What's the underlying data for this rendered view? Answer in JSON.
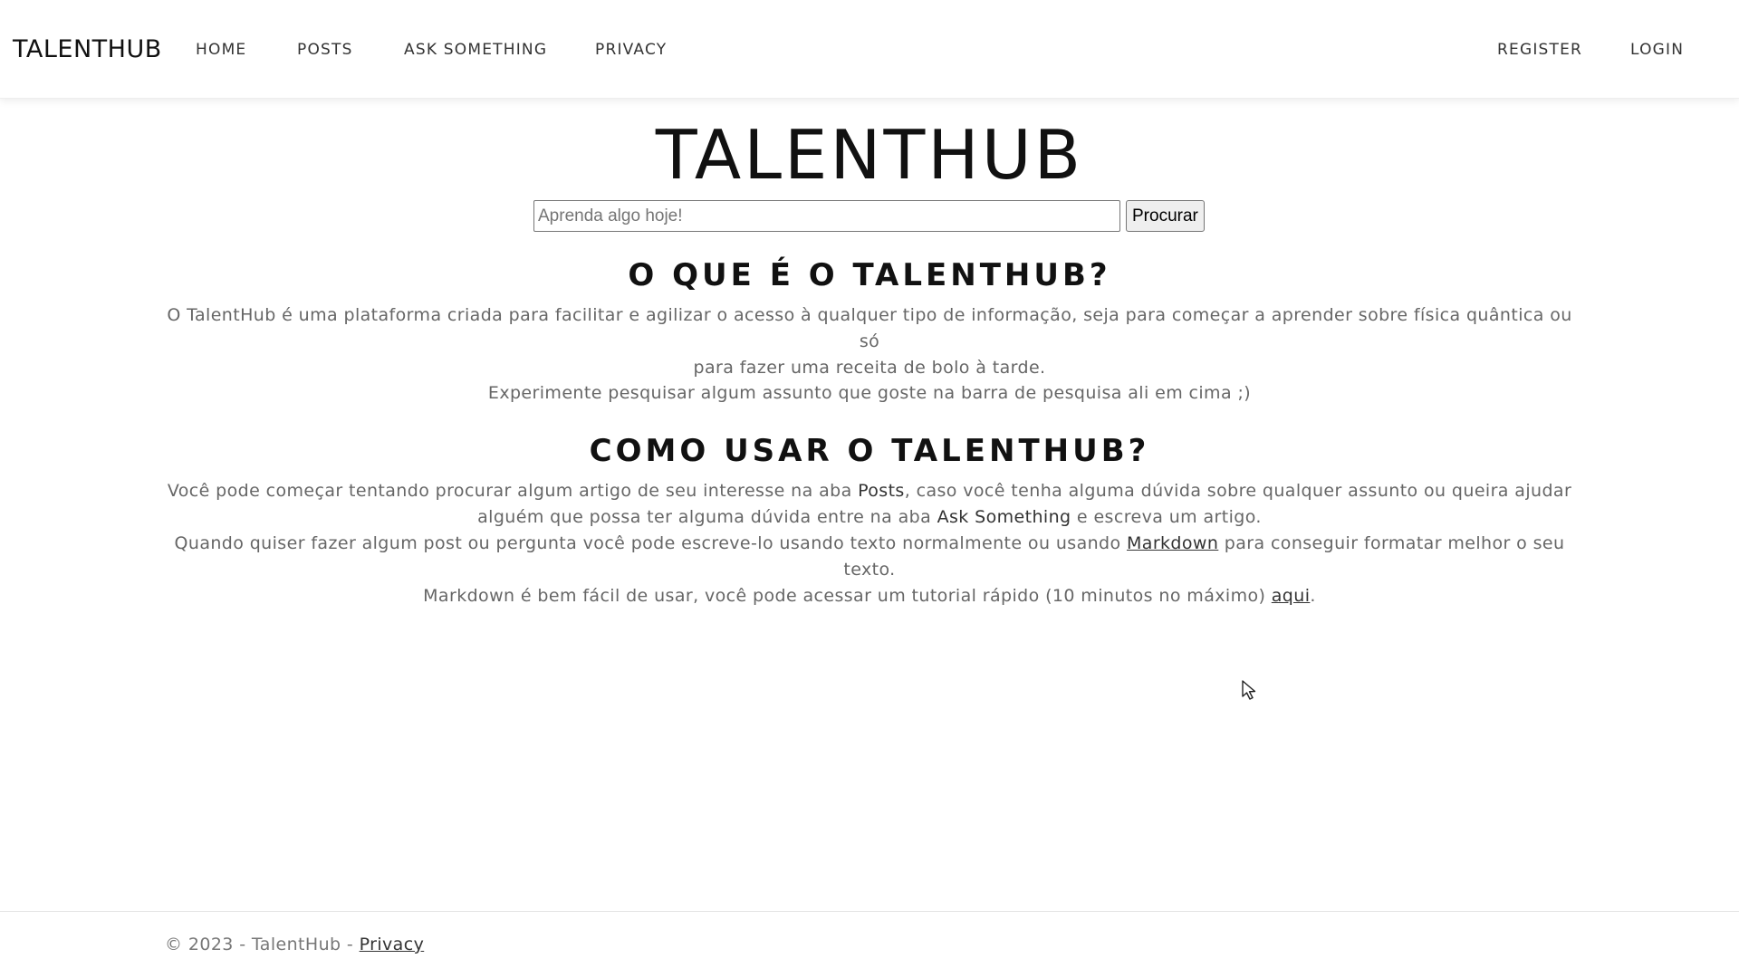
{
  "navbar": {
    "brand": "TALENTHUB",
    "links": [
      {
        "label": "HOME"
      },
      {
        "label": "POSTS"
      },
      {
        "label": "ASK SOMETHING"
      },
      {
        "label": "PRIVACY"
      }
    ],
    "right_links": [
      {
        "label": "REGISTER"
      },
      {
        "label": "LOGIN"
      }
    ]
  },
  "hero": {
    "title": "TALENTHUB"
  },
  "search": {
    "placeholder": "Aprenda algo hoje!",
    "value": "",
    "button_label": "Procurar"
  },
  "section1": {
    "heading": "O QUE É O TALENTHUB?",
    "paragraph_line1": "O TalentHub é uma plataforma criada para facilitar e agilizar o acesso à qualquer tipo de informação, seja para começar a aprender sobre física quântica ou só",
    "paragraph_line2": "para fazer uma receita de bolo à tarde.",
    "tip": "Experimente pesquisar algum assunto que goste na barra de pesquisa ali em cima ;)"
  },
  "section2": {
    "heading": "COMO USAR O TALENTHUB?",
    "p1_part1": "Você pode começar tentando procurar algum artigo de seu interesse na aba ",
    "p1_posts": "Posts",
    "p1_part2": ", caso você tenha alguma dúvida sobre qualquer assunto ou queira ajudar",
    "p1_part3": "alguém que possa ter alguma dúvida entre na aba ",
    "p1_ask": "Ask Something",
    "p1_part4": " e escreva um artigo.",
    "p2_part1": "Quando quiser fazer algum post ou pergunta você pode escreve-lo usando texto normalmente ou usando ",
    "p2_markdown_link": "Markdown",
    "p2_part2": " para conseguir formatar melhor o seu texto.",
    "p3_part1": "Markdown é bem fácil de usar, você pode acessar um tutorial rápido (10 minutos no máximo) ",
    "p3_link": "aqui",
    "p3_part2": "."
  },
  "footer": {
    "copyright": "© 2023 - TalentHub - ",
    "privacy_link": "Privacy"
  },
  "cursor": {
    "icon": "mouse-pointer-icon"
  }
}
